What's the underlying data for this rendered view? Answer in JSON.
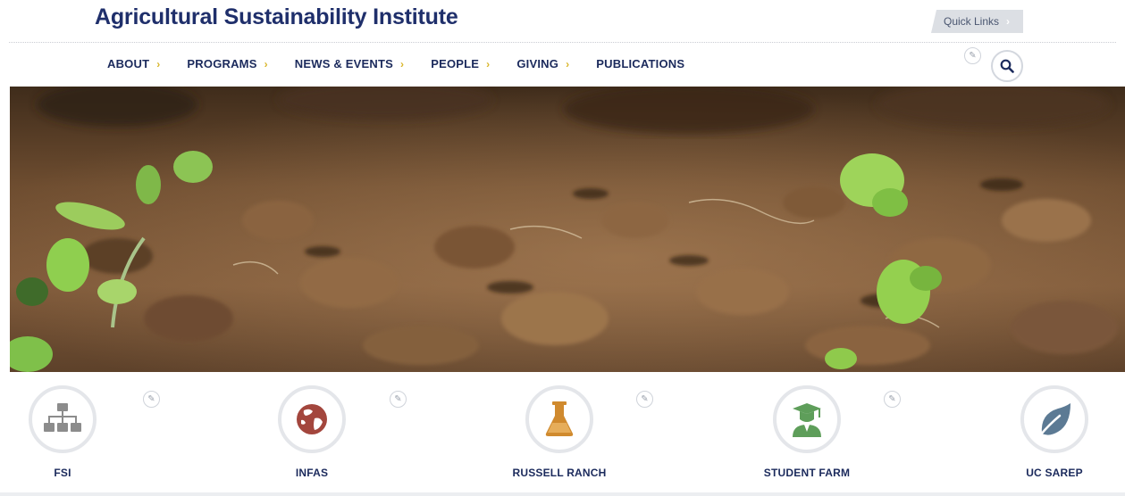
{
  "header": {
    "site_title": "Agricultural Sustainability Institute",
    "quick_links_label": "Quick Links",
    "quick_links_chevron": "›"
  },
  "nav": {
    "items": [
      {
        "label": "ABOUT",
        "has_submenu": true
      },
      {
        "label": "PROGRAMS",
        "has_submenu": true
      },
      {
        "label": "NEWS & EVENTS",
        "has_submenu": true
      },
      {
        "label": "PEOPLE",
        "has_submenu": true
      },
      {
        "label": "GIVING",
        "has_submenu": true
      },
      {
        "label": "PUBLICATIONS",
        "has_submenu": false
      }
    ],
    "submenu_arrow": "›",
    "search_icon": "search-icon",
    "edit_icon": "pencil-icon"
  },
  "hero": {
    "image_subject": "seedlings in tilled soil"
  },
  "features": {
    "items": [
      {
        "label": "FSI",
        "icon": "org-chart-icon",
        "icon_color": "#8c8c8c",
        "editable": true
      },
      {
        "label": "INFAS",
        "icon": "globe-icon",
        "icon_color": "#a3463d",
        "editable": true
      },
      {
        "label": "RUSSELL RANCH",
        "icon": "flask-icon",
        "icon_color": "#d08a2e",
        "editable": true
      },
      {
        "label": "STUDENT FARM",
        "icon": "graduate-icon",
        "icon_color": "#5e9e5a",
        "editable": true
      },
      {
        "label": "UC SAREP",
        "icon": "leaf-icon",
        "icon_color": "#5c7a94",
        "editable": false
      }
    ]
  },
  "colors": {
    "brand_navy": "#1f2f6b",
    "accent_gold": "#d9b62b",
    "quick_links_bg": "#dcdfe4"
  }
}
